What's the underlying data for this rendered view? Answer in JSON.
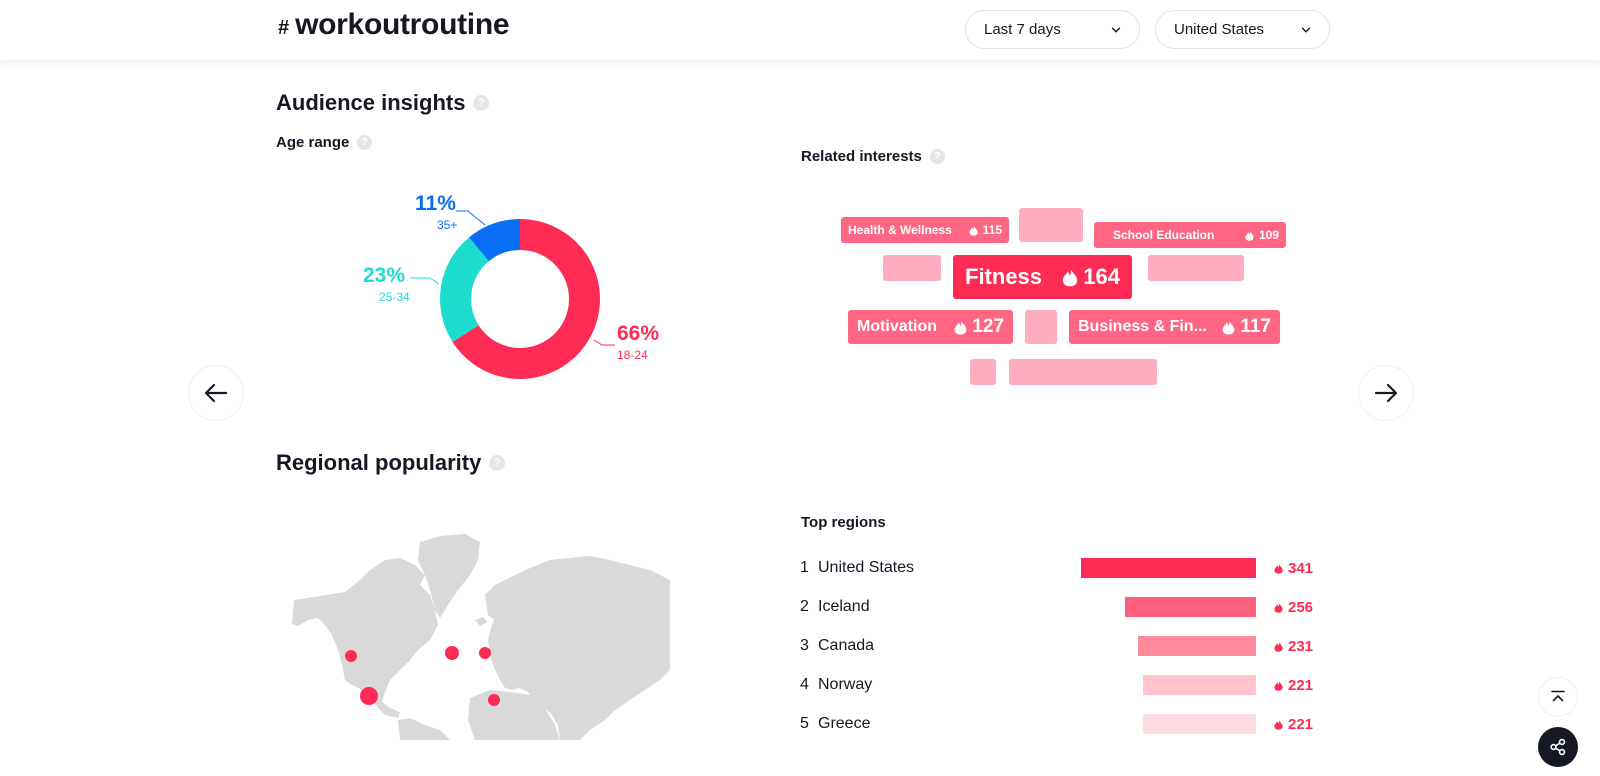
{
  "header": {
    "hash_symbol": "#",
    "hashtag": "workoutroutine",
    "time_filter": {
      "selected": "Last 7 days"
    },
    "region_filter": {
      "selected": "United States"
    }
  },
  "audience": {
    "title": "Audience insights",
    "help": "?",
    "age_range": {
      "title": "Age range",
      "help": "?",
      "segments": [
        {
          "label": "18-24",
          "percent_label": "66%",
          "value": 66,
          "color": "#fe2c55"
        },
        {
          "label": "25-34",
          "percent_label": "23%",
          "value": 23,
          "color": "#1ddcd0"
        },
        {
          "label": "35+",
          "percent_label": "11%",
          "value": 11,
          "color": "#0a6df5"
        }
      ]
    },
    "related_interests": {
      "title": "Related interests",
      "help": "?",
      "tags": [
        {
          "label": "Health & Wellness",
          "count": "115"
        },
        {
          "label": "School Education",
          "count": "109"
        },
        {
          "label": "Fitness",
          "count": "164"
        },
        {
          "label": "Motivation",
          "count": "127"
        },
        {
          "label": "Business & Fin...",
          "count": "117"
        }
      ]
    }
  },
  "regional": {
    "title": "Regional popularity",
    "help": "?",
    "top_regions_title": "Top regions",
    "regions": [
      {
        "rank": "1",
        "name": "United States",
        "value": "341",
        "score": 341,
        "color": "#fe2c55"
      },
      {
        "rank": "2",
        "name": "Iceland",
        "value": "256",
        "score": 256,
        "color": "#fe5f7c"
      },
      {
        "rank": "3",
        "name": "Canada",
        "value": "231",
        "score": 231,
        "color": "#fe8a9c"
      },
      {
        "rank": "4",
        "name": "Norway",
        "value": "221",
        "score": 221,
        "color": "#ffc4cd"
      },
      {
        "rank": "5",
        "name": "Greece",
        "value": "221",
        "score": 221,
        "color": "#ffdbe1"
      }
    ]
  },
  "colors": {
    "accent": "#fe2c55",
    "tag_mid": "#fe6683",
    "placeholder": "#ffadc0",
    "map_land": "#d9d9d9"
  }
}
